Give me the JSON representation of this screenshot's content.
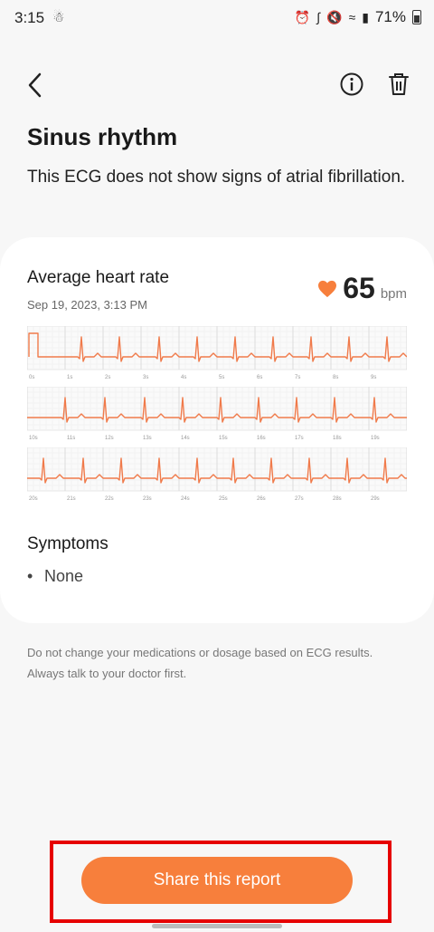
{
  "status_bar": {
    "time": "3:15",
    "battery": "71%"
  },
  "report": {
    "title": "Sinus rhythm",
    "description": "This ECG does not show signs of atrial fibrillation."
  },
  "heart_rate": {
    "label": "Average heart rate",
    "date": "Sep 19, 2023, 3:13 PM",
    "value": "65",
    "unit": "bpm"
  },
  "ecg": {
    "color": "#f07a4a",
    "strips": [
      {
        "ticks": [
          "0s",
          "1s",
          "2s",
          "3s",
          "4s",
          "5s",
          "6s",
          "7s",
          "8s",
          "9s"
        ]
      },
      {
        "ticks": [
          "10s",
          "11s",
          "12s",
          "13s",
          "14s",
          "15s",
          "16s",
          "17s",
          "18s",
          "19s"
        ]
      },
      {
        "ticks": [
          "20s",
          "21s",
          "22s",
          "23s",
          "24s",
          "25s",
          "26s",
          "27s",
          "28s",
          "29s"
        ]
      }
    ]
  },
  "symptoms": {
    "title": "Symptoms",
    "items": [
      "None"
    ]
  },
  "disclaimer": "Do not change your medications or dosage based on ECG results. Always talk to your doctor first.",
  "share_button": {
    "label": "Share this report"
  },
  "colors": {
    "accent": "#f77f3c",
    "highlight": "#e60000"
  }
}
